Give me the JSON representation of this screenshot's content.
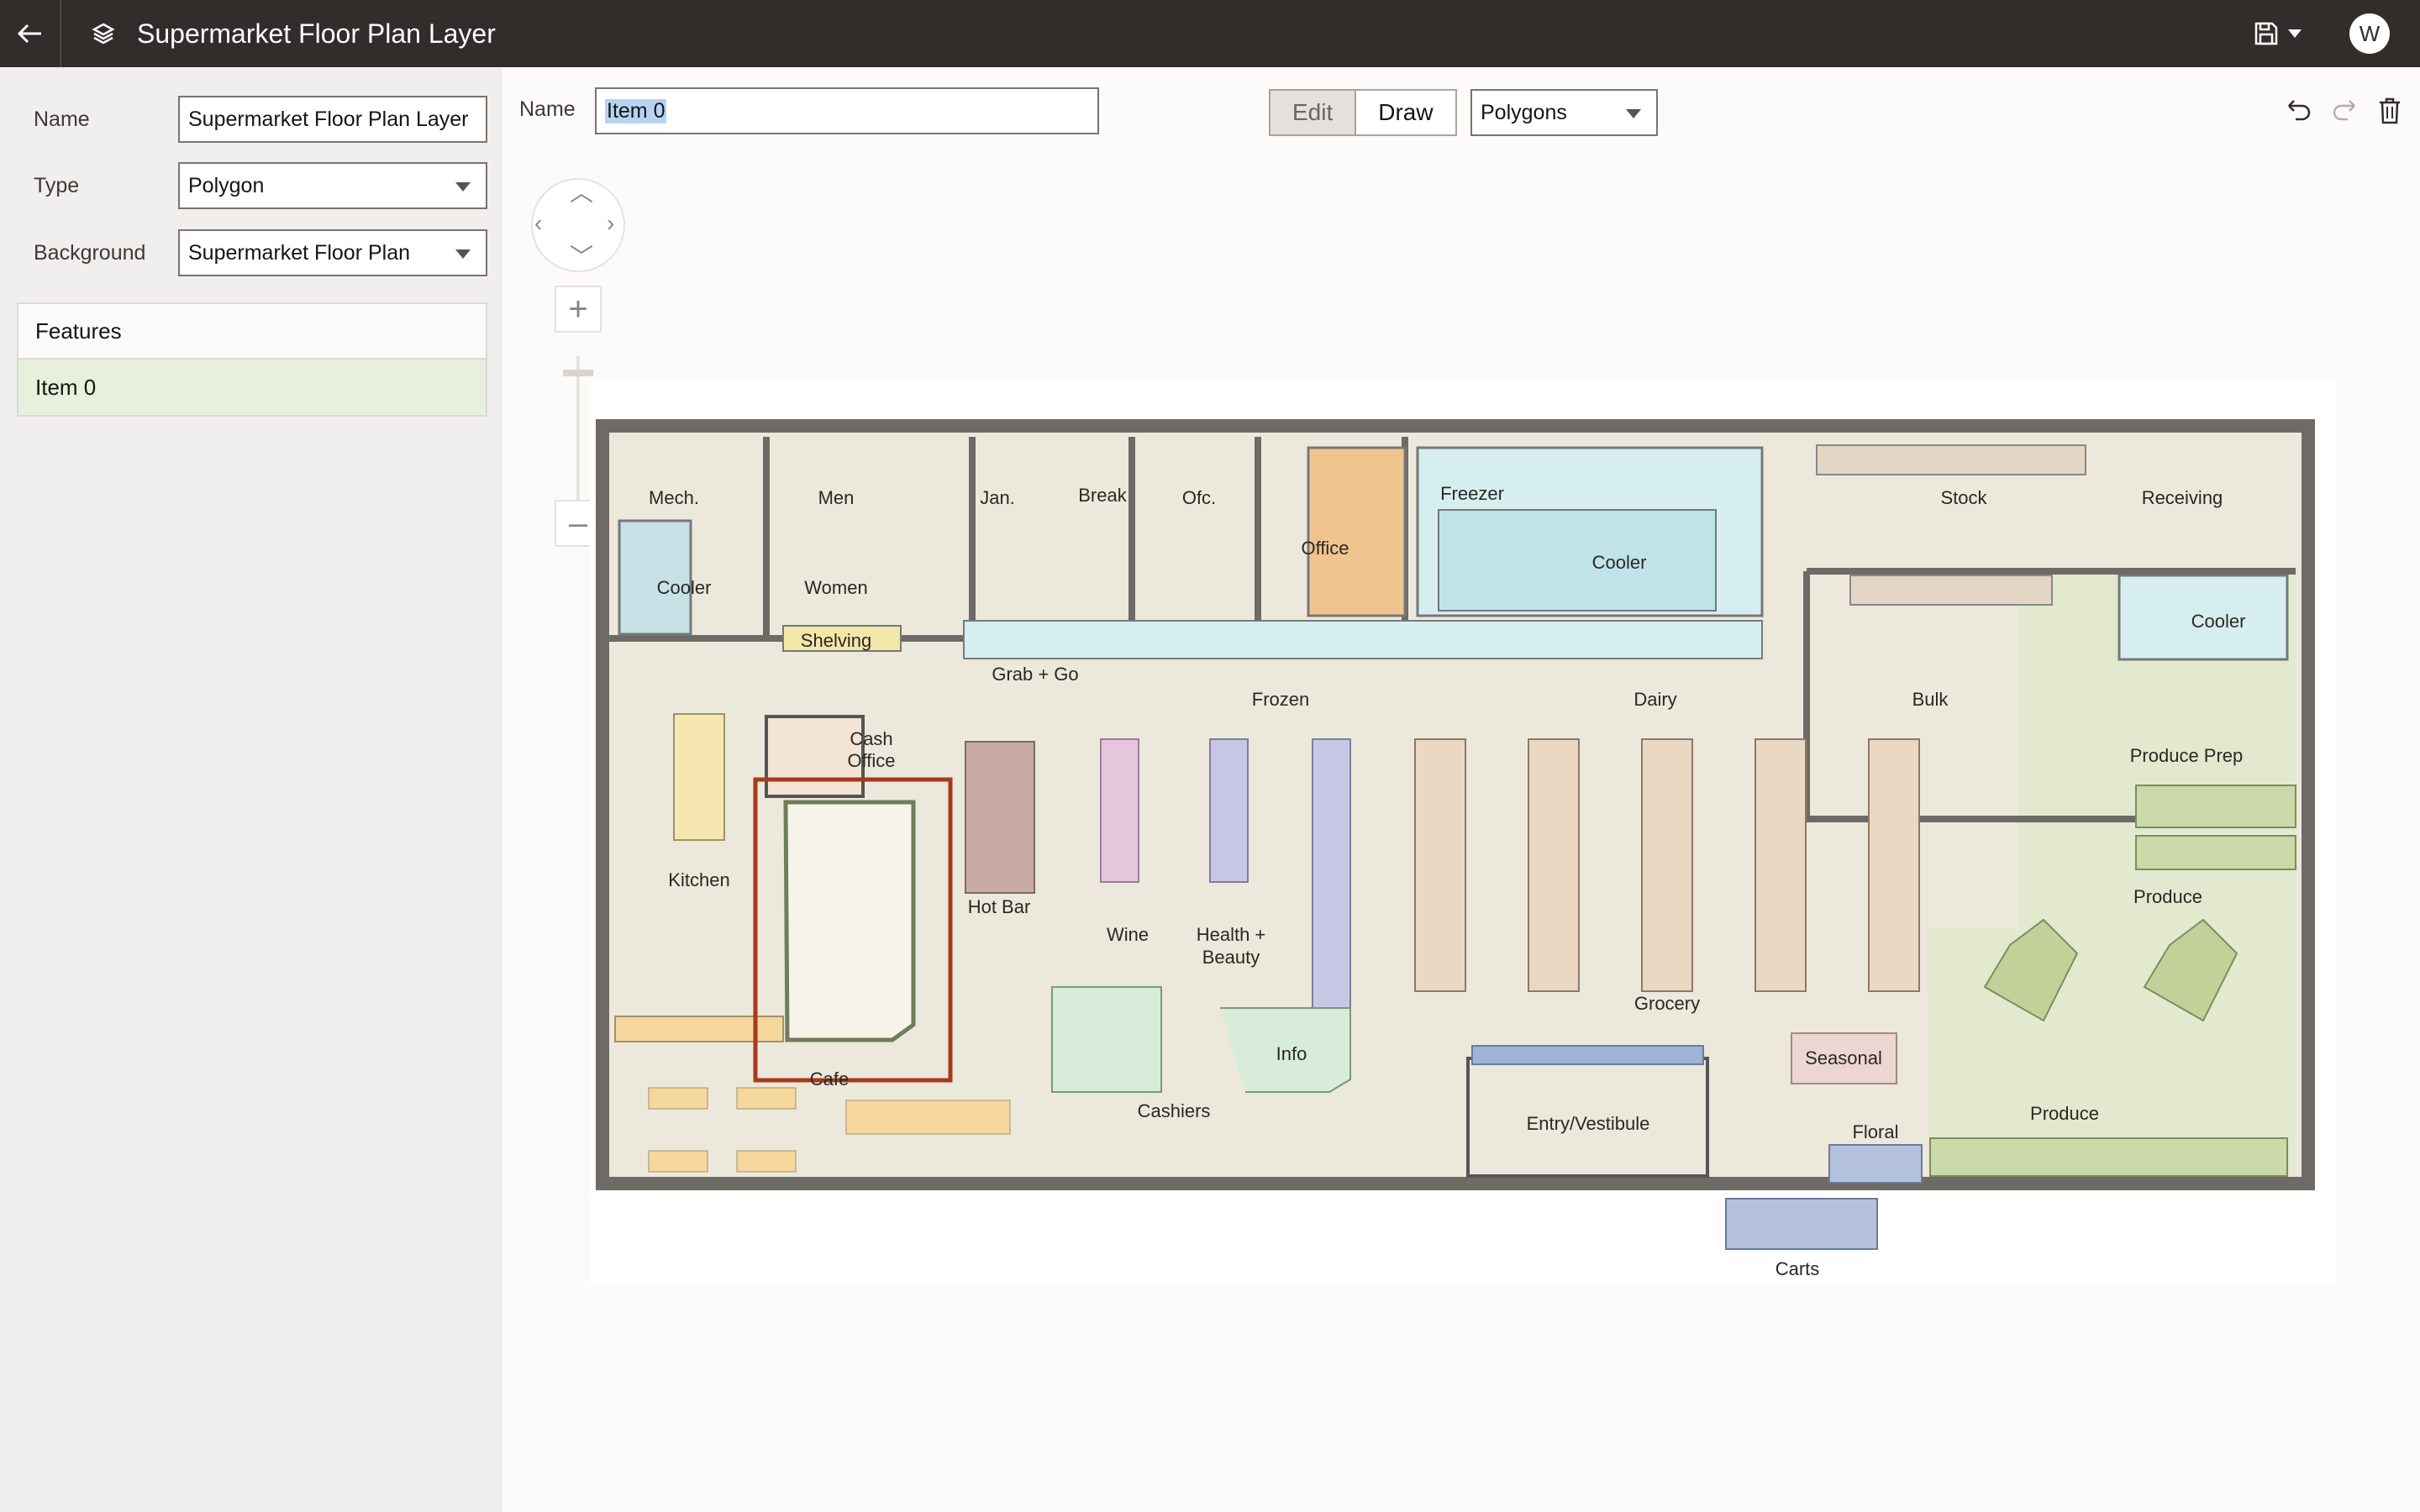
{
  "app": {
    "title": "Supermarket Floor Plan Layer",
    "avatar_initial": "W"
  },
  "properties": {
    "name_label": "Name",
    "name_value": "Supermarket Floor Plan Layer",
    "type_label": "Type",
    "type_value": "Polygon",
    "background_label": "Background",
    "background_value": "Supermarket Floor Plan"
  },
  "features": {
    "header": "Features",
    "items": [
      {
        "label": "Item 0"
      }
    ]
  },
  "toolbar": {
    "name_label": "Name",
    "name_value": "Item 0",
    "modes": [
      {
        "label": "Edit",
        "active": true
      },
      {
        "label": "Draw",
        "active": false
      }
    ],
    "draw_type": "Polygons"
  },
  "icons": {
    "back": "arrow-left-icon",
    "layers": "layers-icon",
    "save": "save-icon",
    "undo": "undo-icon",
    "redo": "redo-icon",
    "delete": "trash-icon"
  },
  "floor_plan": {
    "rooms": {
      "mech": "Mech.",
      "men": "Men",
      "jan": "Jan.",
      "break": "Break",
      "ofc": "Ofc.",
      "office": "Office",
      "freezer": "Freezer",
      "cooler_mid": "Cooler",
      "stock": "Stock",
      "receiving": "Receiving",
      "cooler_left": "Cooler",
      "women": "Women",
      "shelving": "Shelving",
      "grab_go": "Grab + Go",
      "frozen": "Frozen",
      "dairy": "Dairy",
      "bulk": "Bulk",
      "cooler_right": "Cooler",
      "cash": "Cash",
      "office2": "Office",
      "produce_prep": "Produce Prep",
      "kitchen": "Kitchen",
      "hot_bar": "Hot Bar",
      "wine": "Wine",
      "health": "Health +",
      "beauty": "Beauty",
      "produce_top": "Produce",
      "grocery": "Grocery",
      "info": "Info",
      "seasonal": "Seasonal",
      "cafe": "Cafe",
      "cashiers": "Cashiers",
      "produce_bottom": "Produce",
      "entry": "Entry/Vestibule",
      "floral": "Floral",
      "carts": "Carts"
    }
  }
}
